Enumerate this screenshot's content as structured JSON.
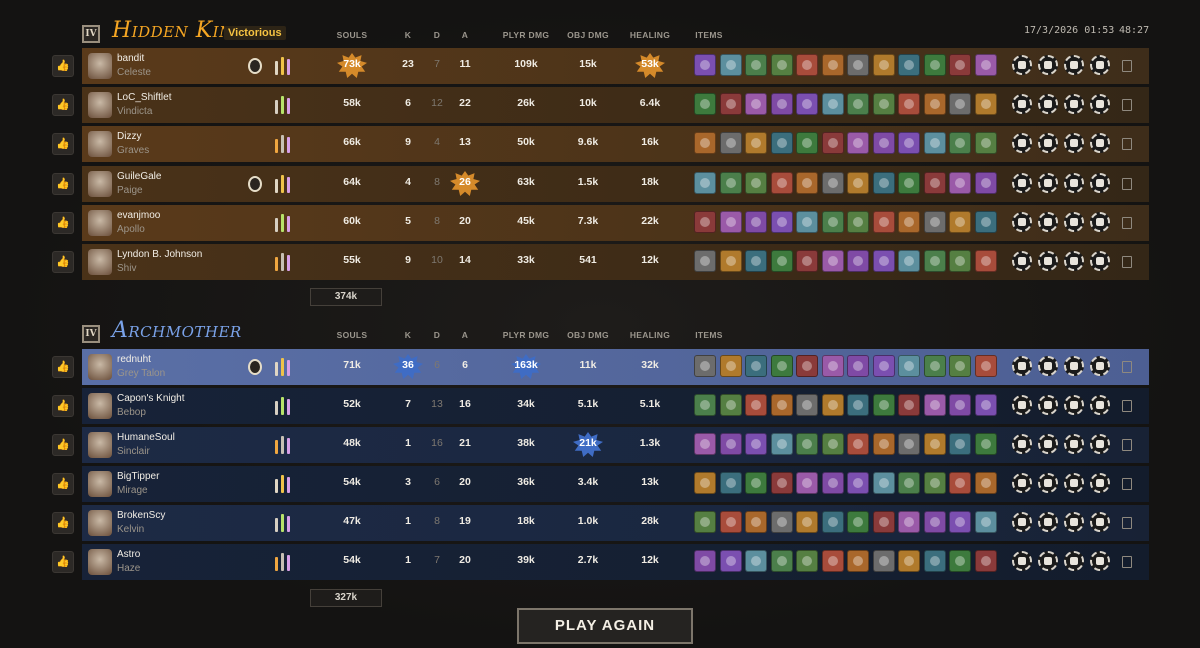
{
  "header": {
    "date": "17/3/2026 01:53",
    "duration": "48:27"
  },
  "columns": {
    "souls": "SOULS",
    "k": "K",
    "d": "D",
    "a": "A",
    "plyr_dmg": "PLYR DMG",
    "obj_dmg": "OBJ DMG",
    "healing": "HEALING",
    "items": "ITEMS"
  },
  "teams": [
    {
      "rank": "IV",
      "name": "Hidden King",
      "result": "Victorious",
      "total_souls": "374k",
      "color": "#f5a623",
      "players": [
        {
          "name": "bandit",
          "hero": "Celeste",
          "souls": "73k",
          "k": "23",
          "d": "7",
          "a": "11",
          "plyr_dmg": "109k",
          "obj_dmg": "15k",
          "healing": "53k"
        },
        {
          "name": "LoC_Shiftlet",
          "hero": "Vindicta",
          "souls": "58k",
          "k": "6",
          "d": "12",
          "a": "22",
          "plyr_dmg": "26k",
          "obj_dmg": "10k",
          "healing": "6.4k"
        },
        {
          "name": "Dizzy",
          "hero": "Graves",
          "souls": "66k",
          "k": "9",
          "d": "4",
          "a": "13",
          "plyr_dmg": "50k",
          "obj_dmg": "9.6k",
          "healing": "16k"
        },
        {
          "name": "GuileGale",
          "hero": "Paige",
          "souls": "64k",
          "k": "4",
          "d": "8",
          "a": "26",
          "plyr_dmg": "63k",
          "obj_dmg": "1.5k",
          "healing": "18k"
        },
        {
          "name": "evanjmoo",
          "hero": "Apollo",
          "souls": "60k",
          "k": "5",
          "d": "8",
          "a": "20",
          "plyr_dmg": "45k",
          "obj_dmg": "7.3k",
          "healing": "22k"
        },
        {
          "name": "Lyndon B. Johnson",
          "hero": "Shiv",
          "souls": "55k",
          "k": "9",
          "d": "10",
          "a": "14",
          "plyr_dmg": "33k",
          "obj_dmg": "541",
          "healing": "12k"
        }
      ]
    },
    {
      "rank": "IV",
      "name": "Archmother",
      "result": "",
      "total_souls": "327k",
      "color": "#7aa2e8",
      "players": [
        {
          "name": "rednuht",
          "hero": "Grey Talon",
          "souls": "71k",
          "k": "36",
          "d": "6",
          "a": "6",
          "plyr_dmg": "163k",
          "obj_dmg": "11k",
          "healing": "32k"
        },
        {
          "name": "Capon's Knight",
          "hero": "Bebop",
          "souls": "52k",
          "k": "7",
          "d": "13",
          "a": "16",
          "plyr_dmg": "34k",
          "obj_dmg": "5.1k",
          "healing": "5.1k"
        },
        {
          "name": "HumaneSoul",
          "hero": "Sinclair",
          "souls": "48k",
          "k": "1",
          "d": "16",
          "a": "21",
          "plyr_dmg": "38k",
          "obj_dmg": "21k",
          "healing": "1.3k"
        },
        {
          "name": "BigTipper",
          "hero": "Mirage",
          "souls": "54k",
          "k": "3",
          "d": "6",
          "a": "20",
          "plyr_dmg": "36k",
          "obj_dmg": "3.4k",
          "healing": "13k"
        },
        {
          "name": "BrokenScy",
          "hero": "Kelvin",
          "souls": "47k",
          "k": "1",
          "d": "8",
          "a": "19",
          "plyr_dmg": "18k",
          "obj_dmg": "1.0k",
          "healing": "28k"
        },
        {
          "name": "Astro",
          "hero": "Haze",
          "souls": "54k",
          "k": "1",
          "d": "7",
          "a": "20",
          "plyr_dmg": "39k",
          "obj_dmg": "2.7k",
          "healing": "12k"
        }
      ]
    }
  ],
  "play_again": "PLAY AGAIN"
}
